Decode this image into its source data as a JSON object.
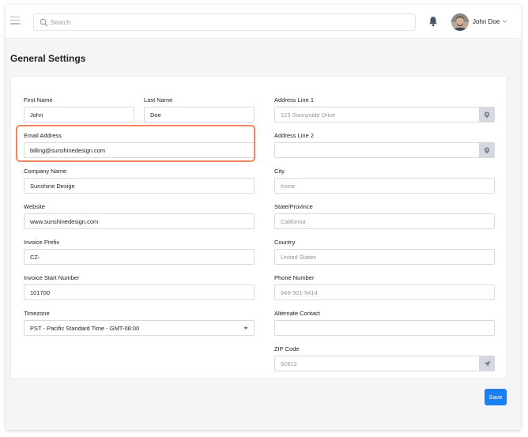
{
  "header": {
    "search_placeholder": "Search",
    "user_name": "John Doe"
  },
  "page": {
    "title": "General Settings"
  },
  "form": {
    "left": {
      "first_name": {
        "label": "First Name",
        "value": "John"
      },
      "last_name": {
        "label": "Last Name",
        "value": "Doe"
      },
      "email": {
        "label": "Email Address",
        "value": "billing@sunshinedesign.com"
      },
      "company": {
        "label": "Company Name",
        "value": "Sunshine Design"
      },
      "website": {
        "label": "Website",
        "value": "www.sunshinedesign.com"
      },
      "invoice_prefix": {
        "label": "Invoice Prefix",
        "value": "CZ-"
      },
      "invoice_start": {
        "label": "Invoice Start Number",
        "value": "101700"
      },
      "timezone": {
        "label": "Timezone",
        "value": "PST - Pacific Standard Time - GMT-08:00"
      }
    },
    "right": {
      "address1": {
        "label": "Address Line 1",
        "placeholder": "123 Sunnyside Drive"
      },
      "address2": {
        "label": "Address Line 2",
        "placeholder": ""
      },
      "city": {
        "label": "City",
        "placeholder": "Irvine"
      },
      "state": {
        "label": "State/Province",
        "placeholder": "California"
      },
      "country": {
        "label": "Country",
        "placeholder": "United States"
      },
      "phone": {
        "label": "Phone Number",
        "placeholder": "949-301-9414"
      },
      "alt_contact": {
        "label": "Alternate Contact",
        "placeholder": ""
      },
      "zip": {
        "label": "ZIP Code",
        "placeholder": "92612"
      }
    }
  },
  "actions": {
    "save_label": "Save"
  },
  "colors": {
    "accent": "#1a7ff0",
    "highlight": "#f08560",
    "addon_bg": "#d5d9df"
  },
  "icons": {
    "menu": "menu-icon",
    "search": "search-icon",
    "bell": "bell-icon",
    "location": "location-pin-icon",
    "send": "send-arrow-icon"
  }
}
